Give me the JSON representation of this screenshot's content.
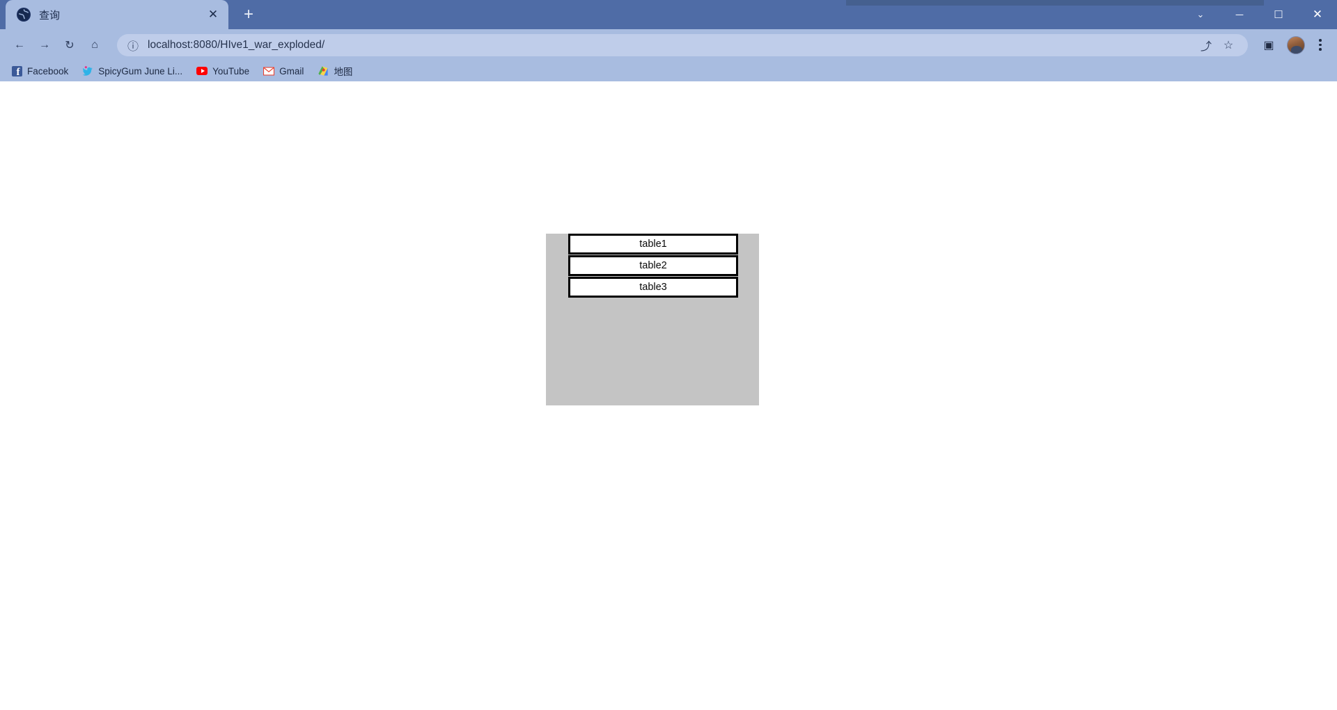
{
  "window": {
    "controls": [
      {
        "name": "chevron-down",
        "glyph": "⌄"
      },
      {
        "name": "minimize",
        "glyph": "─"
      },
      {
        "name": "maximize",
        "glyph": "☐"
      },
      {
        "name": "close",
        "glyph": "✕"
      }
    ]
  },
  "tabstrip": {
    "tab_title": "查询",
    "close_glyph": "✕",
    "newtab_glyph": "+"
  },
  "toolbar": {
    "back_glyph": "←",
    "forward_glyph": "→",
    "reload_glyph": "↻",
    "home_glyph": "⌂",
    "info_glyph": "ⓘ",
    "url": "localhost:8080/HIve1_war_exploded/",
    "share_glyph": "⤴",
    "bookmark_star_glyph": "☆",
    "sidepanel_glyph": "▣",
    "menu_name": "chrome-menu"
  },
  "bookmarks": [
    {
      "label": "Facebook",
      "icon": "facebook-icon"
    },
    {
      "label": "SpicyGum June Li...",
      "icon": "twitter-icon"
    },
    {
      "label": "YouTube",
      "icon": "youtube-icon"
    },
    {
      "label": "Gmail",
      "icon": "gmail-icon"
    },
    {
      "label": "地图",
      "icon": "google-maps-icon"
    }
  ],
  "page": {
    "panel_background": "#c4c4c4",
    "buttons": [
      {
        "label": "table1"
      },
      {
        "label": "table2"
      },
      {
        "label": "table3"
      }
    ]
  }
}
